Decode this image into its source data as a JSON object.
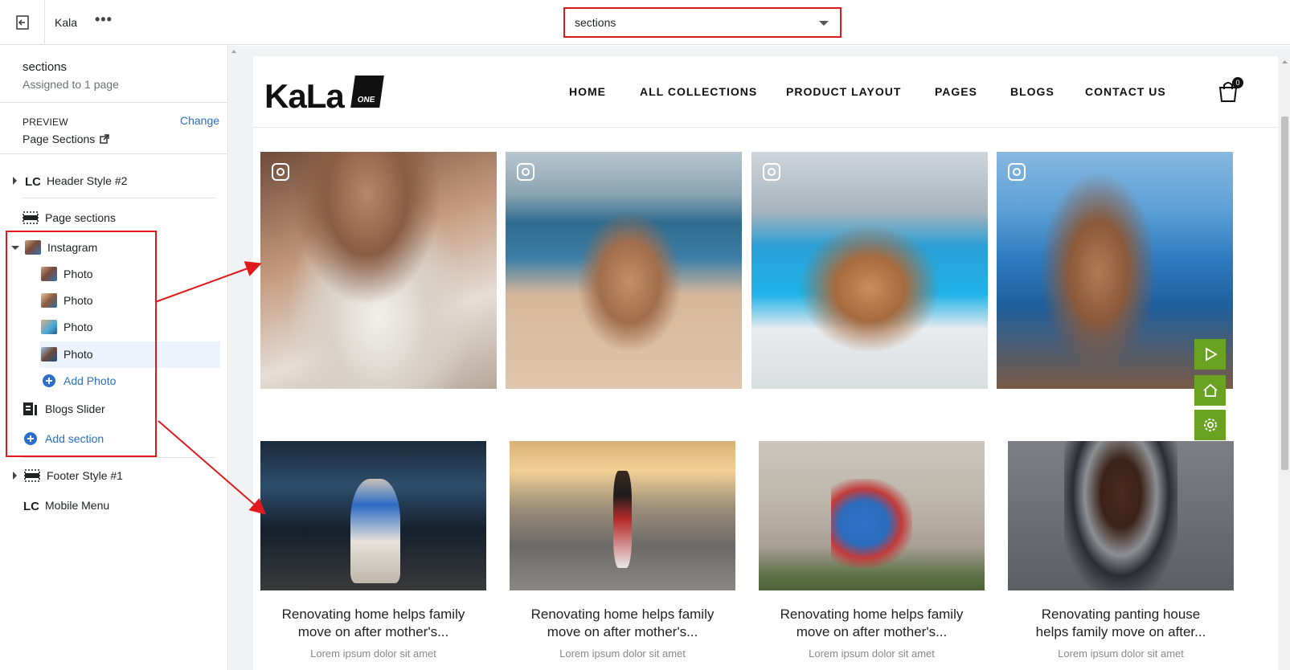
{
  "topbar": {
    "store_name": "Kala",
    "more_label": "•••",
    "template_select_value": "sections"
  },
  "sidebar": {
    "title": "sections",
    "assigned": "Assigned to 1 page",
    "preview_label": "PREVIEW",
    "preview_change": "Change",
    "preview_value": "Page Sections",
    "items": [
      {
        "label": "Header Style #2",
        "icon": "header-layout-icon"
      },
      {
        "label": "Page sections",
        "icon": "section-icon"
      },
      {
        "label": "Instagram",
        "icon": "image-thumbnail-icon"
      },
      {
        "label": "Photo",
        "icon": "photo-thumbnail-icon"
      },
      {
        "label": "Photo",
        "icon": "photo-thumbnail-icon"
      },
      {
        "label": "Photo",
        "icon": "photo-thumbnail-icon"
      },
      {
        "label": "Photo",
        "icon": "photo-thumbnail-icon"
      },
      {
        "label": "Add Photo",
        "icon": "plus-circle-icon"
      },
      {
        "label": "Blogs Slider",
        "icon": "blog-icon"
      },
      {
        "label": "Add section",
        "icon": "plus-circle-icon"
      },
      {
        "label": "Footer Style #1",
        "icon": "section-icon"
      },
      {
        "label": "Mobile Menu",
        "icon": "lc-logo-icon"
      }
    ]
  },
  "store": {
    "logo_text": "KaLa",
    "logo_badge": "ONE",
    "nav": [
      "HOME",
      "ALL COLLECTIONS",
      "PRODUCT LAYOUT",
      "PAGES",
      "BLOGS",
      "CONTACT US"
    ],
    "cart_count": "0"
  },
  "blogs": [
    {
      "title_line1": "Renovating home helps family",
      "title_line2": "move on after mother's...",
      "excerpt": "Lorem ipsum dolor sit amet"
    },
    {
      "title_line1": "Renovating home helps family",
      "title_line2": "move on after mother's...",
      "excerpt": "Lorem ipsum dolor sit amet"
    },
    {
      "title_line1": "Renovating home helps family",
      "title_line2": "move on after mother's...",
      "excerpt": "Lorem ipsum dolor sit amet"
    },
    {
      "title_line1": "Renovating panting house",
      "title_line2": "helps family move on after...",
      "excerpt": "Lorem ipsum dolor sit amet"
    }
  ],
  "colors": {
    "accent_link": "#2c6ecb",
    "annotation_red": "#e0191c",
    "float_button_green": "#6aa321"
  }
}
